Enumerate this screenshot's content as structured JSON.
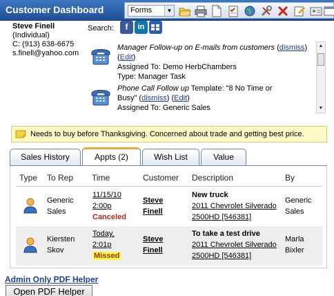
{
  "window": {
    "title": "Customer Dashboard"
  },
  "toolbar": {
    "forms_select": "Forms",
    "icons": [
      "folder-open-icon",
      "print-icon",
      "new-document-icon",
      "checklist-icon",
      "globe-icon",
      "tools-icon",
      "delete-icon",
      "edit-form-icon",
      "contact-card-icon",
      "window-icon"
    ]
  },
  "contact": {
    "name": "Steve Finell",
    "type": "(Individual)",
    "phone": "C: (913) 638-6675",
    "email": "s.finell@yahoo.com"
  },
  "search": {
    "label": "Search:",
    "services": [
      "f",
      "in",
      "yahoo"
    ]
  },
  "tasks": [
    {
      "title": "Manager Follow-up on E-mails from customers",
      "dismiss": "dismiss",
      "edit": "Edit",
      "assigned": "Assigned To: Demo HerbChambers",
      "type": "Type: Manager Task"
    },
    {
      "title_prefix": "Phone Call Follow up",
      "title_suffix": " Template: \"8 No Time or",
      "line2": "Busy\"",
      "dismiss": "dismiss",
      "edit": "Edit",
      "assigned": "Assigned To: Generic Sales"
    }
  ],
  "note": {
    "text": "Needs to buy before Thanksgiving. Concerned about trade and getting best price."
  },
  "tabs": [
    {
      "label": "Sales History",
      "active": false
    },
    {
      "label": "Appts (2)",
      "active": true
    },
    {
      "label": "Wish List",
      "active": false
    },
    {
      "label": "Value",
      "active": false
    }
  ],
  "appts": {
    "columns": [
      "Type",
      "To Rep",
      "Time",
      "Customer",
      "Description",
      "By"
    ],
    "rows": [
      {
        "rep_line1": "Generic",
        "rep_line2": "Sales",
        "date": "11/15/10",
        "time": "2:00p",
        "status": "Canceled",
        "customer_line1": "Steve",
        "customer_line2": "Finell",
        "desc_title": "New truck",
        "desc_vehicle1": "2011 Chevrolet Silverado",
        "desc_vehicle2": "2500HD [546381]",
        "by_line1": "Generic",
        "by_line2": "Sales"
      },
      {
        "rep_line1": "Kiersten",
        "rep_line2": "Skov",
        "date": "Today,",
        "time": "2:01p",
        "status": "Missed",
        "customer_line1": "Steve",
        "customer_line2": "Finell",
        "desc_title": "To take a test drive",
        "desc_vehicle1": "2011 Chevrolet Silverado",
        "desc_vehicle2": "2500HD [546381]",
        "by_line1": "Marla",
        "by_line2": "Bixler"
      }
    ]
  },
  "footer": {
    "admin_link": "Admin Only PDF Helper",
    "pdf_button": "Open PDF Helper"
  },
  "colors": {
    "titlebar": "#1e4f96",
    "status_red": "#b2241c",
    "highlight": "#ffff3a",
    "note_bg": "#fdf8c6",
    "active_tab_accent": "#f0a73a"
  }
}
